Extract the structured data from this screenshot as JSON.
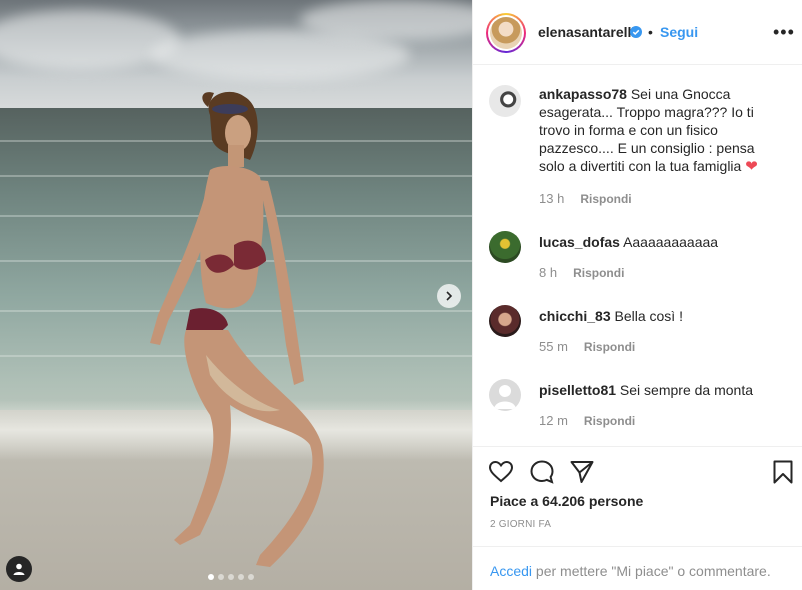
{
  "post": {
    "username": "elenasantarelli",
    "separator": "•",
    "follow_label": "Segui",
    "more_icon": "more-icon",
    "carousel_dots": 5,
    "carousel_active": 1
  },
  "comments": [
    {
      "user": "ankapasso78",
      "text": "Sei una Gnocca esagerata... Troppo magra??? Io ti trovo in forma e con un fisico pazzesco.... E un consiglio : pensa solo a divertiti con la tua famiglia",
      "emoji": "❤",
      "time": "13 h",
      "reply": "Rispondi"
    },
    {
      "user": "lucas_dofas",
      "text": "Aaaaaaaaaaaa",
      "time": "8 h",
      "reply": "Rispondi"
    },
    {
      "user": "chicchi_83",
      "text": "Bella così !",
      "time": "55 m",
      "reply": "Rispondi"
    },
    {
      "user": "piselletto81",
      "text": "Sei sempre da monta",
      "time": "12 m",
      "reply": "Rispondi"
    }
  ],
  "actions": {
    "likes": "Piace a 64.206 persone",
    "time_ago": "2 GIORNI FA"
  },
  "login": {
    "link": "Accedi",
    "rest": " per mettere \"Mi piace\" o commentare."
  },
  "colors": {
    "link": "#3897f0",
    "text": "#262626",
    "muted": "#8e8e8e",
    "heart": "#ed4956"
  }
}
